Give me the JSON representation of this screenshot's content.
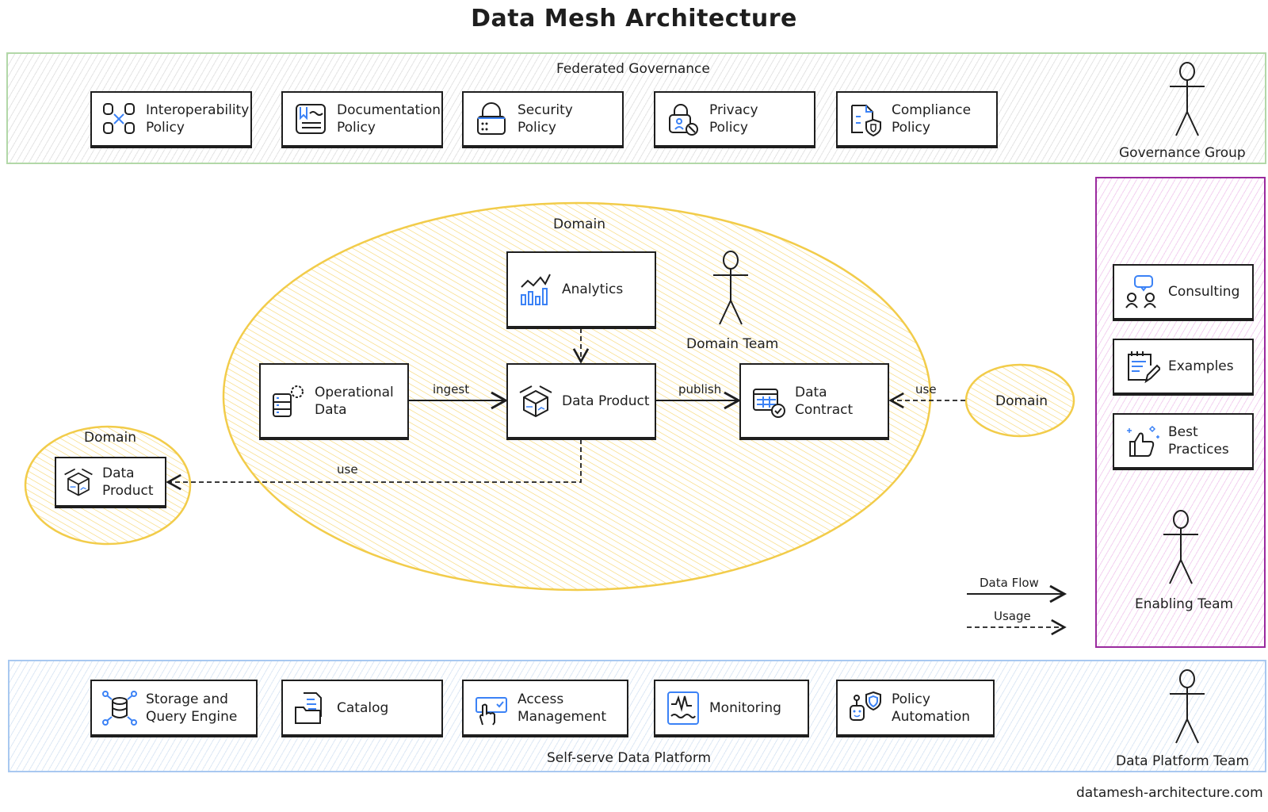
{
  "title": "Data Mesh Architecture",
  "footer": "datamesh-architecture.com",
  "colors": {
    "governance_border": "#b2d8a8",
    "platform_border": "#a8c8f0",
    "enabling_border": "#9a2a9e",
    "domain_fill": "#f7d56a",
    "icon_accent": "#3b82f6",
    "ink": "#1e1e1e"
  },
  "governance": {
    "label": "Federated Governance",
    "actor": "Governance Group",
    "items": [
      {
        "label": "Interoperability\nPolicy",
        "icon": "database-link-icon"
      },
      {
        "label": "Documentation\nPolicy",
        "icon": "document-icon"
      },
      {
        "label": "Security\nPolicy",
        "icon": "padlock-icon"
      },
      {
        "label": "Privacy\nPolicy",
        "icon": "privacy-lock-icon"
      },
      {
        "label": "Compliance\nPolicy",
        "icon": "compliance-shield-icon"
      }
    ]
  },
  "domain": {
    "label": "Domain",
    "actor": "Domain Team",
    "nodes": {
      "analytics": "Analytics",
      "operational": "Operational\nData",
      "product": "Data Product",
      "contract": "Data\nContract"
    },
    "edges": {
      "ingest": "ingest",
      "publish": "publish",
      "use_right": "use",
      "use_left": "use"
    }
  },
  "domain_left": {
    "label": "Domain",
    "product": "Data\nProduct"
  },
  "domain_right": {
    "label": "Domain"
  },
  "legend": {
    "data_flow": "Data Flow",
    "usage": "Usage"
  },
  "enabling": {
    "actor": "Enabling Team",
    "items": [
      {
        "label": "Consulting",
        "icon": "consulting-icon"
      },
      {
        "label": "Examples",
        "icon": "notepad-icon"
      },
      {
        "label": "Best\nPractices",
        "icon": "thumbs-up-icon"
      }
    ]
  },
  "platform": {
    "label": "Self-serve Data Platform",
    "actor": "Data Platform Team",
    "items": [
      {
        "label": "Storage and\nQuery Engine",
        "icon": "storage-icon"
      },
      {
        "label": "Catalog",
        "icon": "catalog-icon"
      },
      {
        "label": "Access\nManagement",
        "icon": "access-icon"
      },
      {
        "label": "Monitoring",
        "icon": "monitoring-icon"
      },
      {
        "label": "Policy\nAutomation",
        "icon": "robot-shield-icon"
      }
    ]
  }
}
